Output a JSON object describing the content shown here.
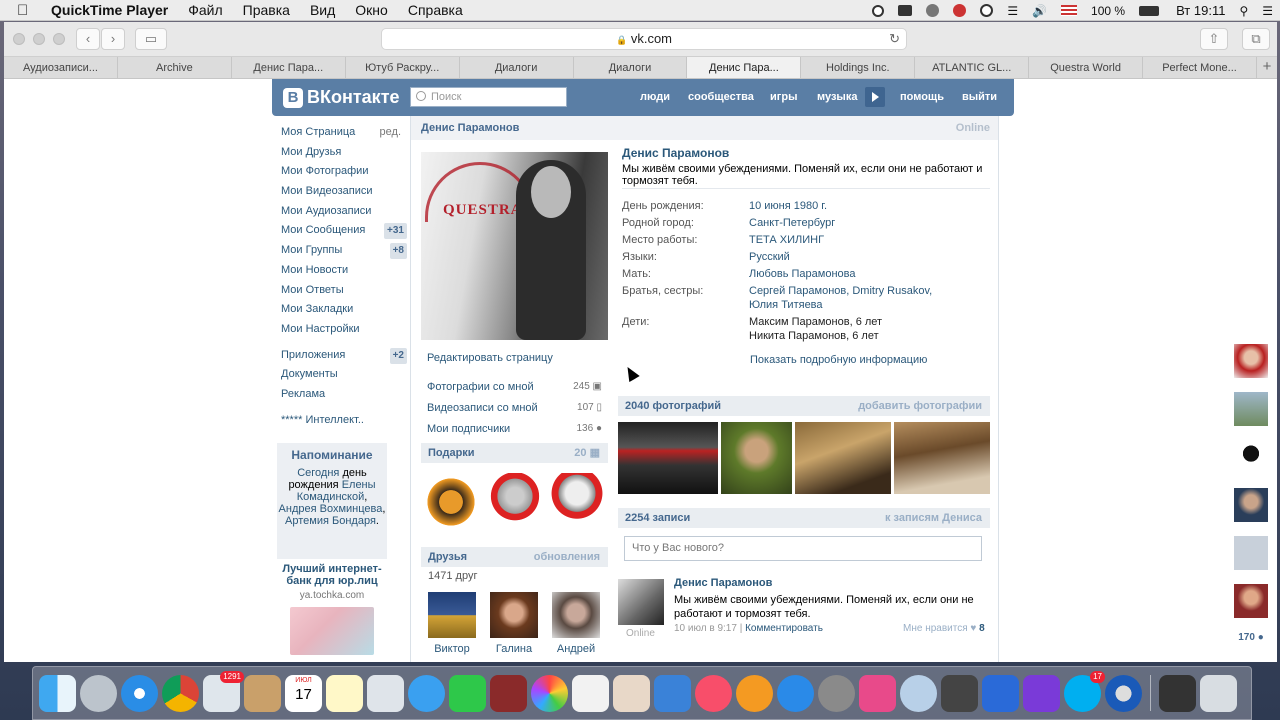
{
  "menubar": {
    "app_name": "QuickTime Player",
    "items": [
      "Файл",
      "Правка",
      "Вид",
      "Окно",
      "Справка"
    ],
    "battery": "100 %",
    "clock": "Вт 19:11"
  },
  "browser": {
    "url": "vk.com",
    "tabs": [
      "Аудиозаписи...",
      "Archive",
      "Денис Пара...",
      "Ютуб Раскру...",
      "Диалоги",
      "Диалоги",
      "Денис Пара...",
      "Holdings Inc.",
      "ATLANTIC GL...",
      "Questra World",
      "Perfect Mone..."
    ],
    "active_tab_index": 6
  },
  "vk": {
    "logo": "ВКонтакте",
    "search_placeholder": "Поиск",
    "nav": [
      "люди",
      "сообщества",
      "игры",
      "музыка",
      "помощь",
      "выйти"
    ],
    "left_menu": [
      {
        "label": "Моя Страница",
        "extra": "ред."
      },
      {
        "label": "Мои Друзья"
      },
      {
        "label": "Мои Фотографии"
      },
      {
        "label": "Мои Видеозаписи"
      },
      {
        "label": "Мои Аудиозаписи"
      },
      {
        "label": "Мои Сообщения",
        "count": "+31"
      },
      {
        "label": "Мои Группы",
        "count": "+8"
      },
      {
        "label": "Мои Новости"
      },
      {
        "label": "Мои Ответы"
      },
      {
        "label": "Мои Закладки"
      },
      {
        "label": "Мои Настройки"
      }
    ],
    "left_menu2": [
      {
        "label": "Приложения",
        "count": "+2"
      },
      {
        "label": "Документы"
      },
      {
        "label": "Реклама"
      }
    ],
    "left_app": "***** Интеллект..",
    "reminder": {
      "title": "Напоминание",
      "text_a": "Сегодня",
      "text_b": "день рождения",
      "n1": "Елены Комадинской",
      "n2": "Андрея Вохминцева",
      "n3": "Артемия Бондаря"
    },
    "ad": {
      "title": "Лучший интернет-банк для юр.лиц",
      "url": "ya.tochka.com"
    },
    "profile": {
      "header_name": "Денис Парамонов",
      "online": "Online",
      "photo_logo": "QUESTRA",
      "edit": "Редактировать страницу",
      "stats": [
        {
          "label": "Фотографии со мной",
          "n": "245"
        },
        {
          "label": "Видеозаписи со мной",
          "n": "107"
        },
        {
          "label": "Мои подписчики",
          "n": "136"
        }
      ],
      "gifts_title": "Подарки",
      "gifts_count": "20",
      "friends_title": "Друзья",
      "friends_updates": "обновления",
      "friends_count": "1471 друг",
      "friends": [
        "Виктор",
        "Галина",
        "Андрей"
      ],
      "name": "Денис Парамонов",
      "status": "Мы живём своими убеждениями. Поменяй их, если они не работают и тормозят тебя.",
      "info": [
        {
          "l": "День рождения:",
          "v": "10 июня 1980 г."
        },
        {
          "l": "Родной город:",
          "v": "Санкт-Петербург"
        },
        {
          "l": "Место работы:",
          "v": "ТЕТА ХИЛИНГ"
        },
        {
          "l": "Языки:",
          "v": "Русский"
        },
        {
          "l": "Мать:",
          "v": "Любовь Парамонова"
        },
        {
          "l": "Братья, сестры:",
          "v": "Сергей Парамонов, Dmitry Rusakov, Юлия Титяева"
        },
        {
          "l": "Дети:",
          "v": "Максим Парамонов, 6 лет",
          "v2": "Никита Парамонов, 6 лет"
        }
      ],
      "more": "Показать подробную информацию",
      "photos_title": "2040 фотографий",
      "photos_add": "добавить фотографии",
      "wall_title": "2254 записи",
      "wall_link": "к записям Дениса",
      "wall_placeholder": "Что у Вас нового?",
      "post": {
        "author": "Денис Парамонов",
        "text": "Мы живём своими убеждениями. Поменяй их, если они не работают и тормозят тебя.",
        "date": "10 июл в 9:17",
        "comment": "Комментировать",
        "like": "Мне нравится",
        "likes": "8",
        "online": "Online"
      }
    },
    "right_count": "170"
  },
  "dock_badges": {
    "mail": "1291",
    "calendar": "ИЮЛ",
    "calendar_day": "17",
    "skype": "17"
  }
}
